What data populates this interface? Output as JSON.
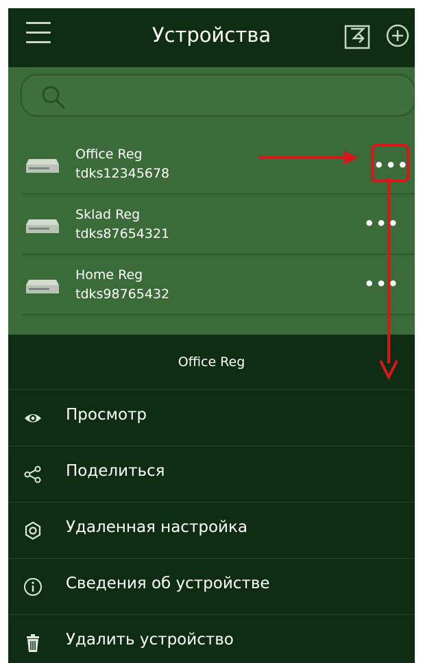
{
  "header": {
    "title": "Устройства",
    "menu_icon": "hamburger-menu-icon",
    "import_icon": "import-icon",
    "add_icon": "add-circle-icon"
  },
  "search": {
    "placeholder": "",
    "icon": "search-icon"
  },
  "devices": [
    {
      "name": "Office Reg",
      "id": "tdks12345678",
      "more": "•••"
    },
    {
      "name": "Sklad Reg",
      "id": "tdks87654321",
      "more": "•••"
    },
    {
      "name": "Home Reg",
      "id": "tdks98765432",
      "more": "•••"
    }
  ],
  "sheet": {
    "title": "Office Reg",
    "items": [
      {
        "label": "Просмотр",
        "icon": "eye-icon"
      },
      {
        "label": "Поделиться",
        "icon": "share-icon"
      },
      {
        "label": "Удаленная настройка",
        "icon": "settings-icon"
      },
      {
        "label": "Сведения об устройстве",
        "icon": "info-icon"
      },
      {
        "label": "Удалить устройство",
        "icon": "trash-icon"
      }
    ]
  },
  "annotation": {
    "color": "#d8161b"
  },
  "colors": {
    "background": "#0f2d12",
    "list_background": "#3b6b39",
    "accent": "#d8161b"
  }
}
